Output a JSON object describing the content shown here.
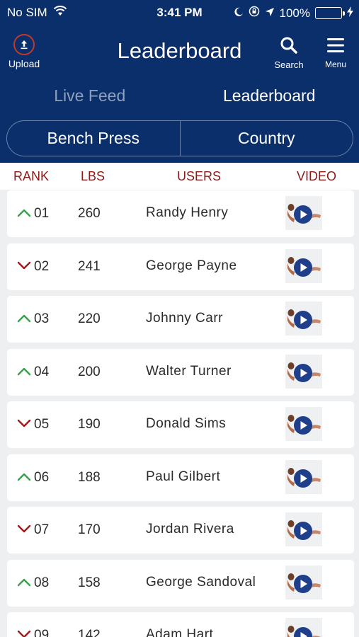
{
  "status_bar": {
    "carrier": "No SIM",
    "time": "3:41 PM",
    "battery": "100%",
    "battery_level": 1.0,
    "icons": [
      "wifi-icon",
      "moon-icon",
      "orientation-lock-icon",
      "location-arrow-icon",
      "battery-icon",
      "charging-icon"
    ]
  },
  "navbar": {
    "upload_label": "Upload",
    "title": "Leaderboard",
    "search_label": "Search",
    "menu_label": "Menu"
  },
  "tabs": [
    {
      "label": "Live Feed",
      "active": false
    },
    {
      "label": "Leaderboard",
      "active": true
    }
  ],
  "filters": {
    "exercise": "Bench Press",
    "scope": "Country"
  },
  "columns": {
    "rank": "RANK",
    "lbs": "LBS",
    "users": "USERS",
    "video": "VIDEO"
  },
  "colors": {
    "navy": "#0b2f6a",
    "header_red": "#8b1a1a",
    "up_green": "#3aa14a",
    "down_red": "#a4161a",
    "play_blue": "#1f3f8a",
    "battery_green": "#4cd964"
  },
  "rows": [
    {
      "trend": "up",
      "rank": "01",
      "lbs": "260",
      "user": "Randy Henry"
    },
    {
      "trend": "down",
      "rank": "02",
      "lbs": "241",
      "user": "George Payne"
    },
    {
      "trend": "up",
      "rank": "03",
      "lbs": "220",
      "user": "Johnny Carr"
    },
    {
      "trend": "up",
      "rank": "04",
      "lbs": "200",
      "user": "Walter Turner"
    },
    {
      "trend": "down",
      "rank": "05",
      "lbs": "190",
      "user": "Donald Sims"
    },
    {
      "trend": "up",
      "rank": "06",
      "lbs": "188",
      "user": "Paul Gilbert"
    },
    {
      "trend": "down",
      "rank": "07",
      "lbs": "170",
      "user": "Jordan Rivera"
    },
    {
      "trend": "up",
      "rank": "08",
      "lbs": "158",
      "user": "George Sandoval"
    },
    {
      "trend": "down",
      "rank": "09",
      "lbs": "142",
      "user": "Adam Hart"
    }
  ]
}
